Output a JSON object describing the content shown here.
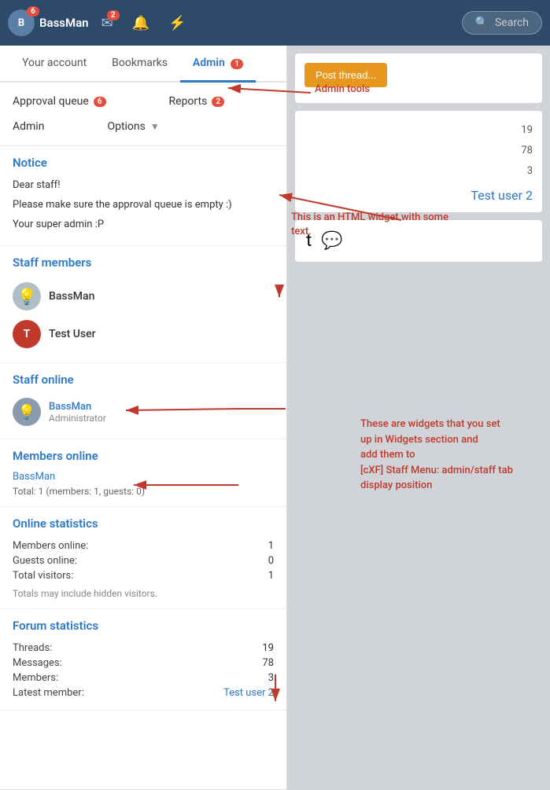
{
  "topnav": {
    "brand": "BassMan",
    "brand_badge": "6",
    "brand_badge2": "2",
    "messages_badge": "2",
    "search_label": "Search"
  },
  "tabs": {
    "items": [
      {
        "label": "Your account",
        "active": false,
        "badge": null
      },
      {
        "label": "Bookmarks",
        "active": false,
        "badge": null
      },
      {
        "label": "Admin",
        "active": true,
        "badge": "1"
      }
    ]
  },
  "submenu": {
    "items": [
      {
        "label": "Approval queue",
        "badge": "6",
        "col": 1
      },
      {
        "label": "Reports",
        "badge": "2",
        "col": 2
      },
      {
        "label": "Admin",
        "badge": null,
        "col": 1
      },
      {
        "label": "Options",
        "dropdown": true,
        "col": 2
      }
    ]
  },
  "notice": {
    "title": "Notice",
    "lines": [
      "Dear staff!",
      "Please make sure the approval queue is empty :)",
      "Your super admin :P"
    ]
  },
  "staff_members": {
    "title": "Staff members",
    "members": [
      {
        "name": "BassMan",
        "avatar_bg": "#8a9bb0",
        "initial": "B",
        "icon": "bulb"
      },
      {
        "name": "Test User",
        "avatar_bg": "#c0392b",
        "initial": "T"
      }
    ]
  },
  "staff_online": {
    "title": "Staff online",
    "members": [
      {
        "name": "BassMan",
        "role": "Administrator"
      }
    ]
  },
  "members_online": {
    "title": "Members online",
    "members": [
      "BassMan"
    ],
    "total": "Total: 1 (members: 1, guests: 0)"
  },
  "online_stats": {
    "title": "Online statistics",
    "rows": [
      {
        "label": "Members online:",
        "value": "1"
      },
      {
        "label": "Guests online:",
        "value": "0"
      },
      {
        "label": "Total visitors:",
        "value": "1"
      }
    ],
    "note": "Totals may include hidden visitors."
  },
  "forum_stats": {
    "title": "Forum statistics",
    "rows": [
      {
        "label": "Threads:",
        "value": "19"
      },
      {
        "label": "Messages:",
        "value": "78"
      },
      {
        "label": "Members:",
        "value": "3"
      },
      {
        "label": "Latest member:",
        "value": "Test user 2",
        "is_link": true
      }
    ]
  },
  "annotations": {
    "admin_tools": "Admin tools",
    "html_widget": "This is an HTML widget with some text.",
    "widgets_desc": "These are widgets that you set\nup in Widgets section and\nadd them to\n[cXF] Staff Menu: admin/staff tab\ndisplay position"
  },
  "bg_numbers": {
    "top_right": [
      "19",
      "78",
      "3"
    ],
    "link": "Test user 2"
  }
}
